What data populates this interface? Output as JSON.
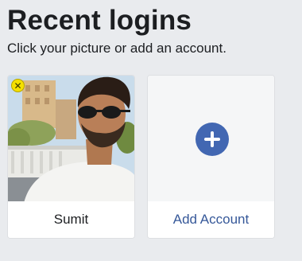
{
  "page": {
    "title": "Recent logins",
    "subtitle": "Click your picture or add an account."
  },
  "accounts": [
    {
      "name": "Sumit",
      "remove_icon": "close-icon",
      "badge_color": "#f5e000"
    }
  ],
  "add_account": {
    "label": "Add Account",
    "icon": "plus-icon",
    "accent_color": "#4267b2"
  }
}
